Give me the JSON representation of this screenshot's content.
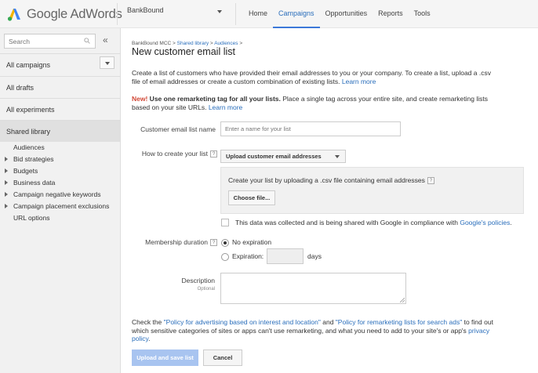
{
  "header": {
    "logo_text": "Google AdWords",
    "account_name": "BankBound",
    "nav": [
      {
        "label": "Home",
        "active": false
      },
      {
        "label": "Campaigns",
        "active": true
      },
      {
        "label": "Opportunities",
        "active": false
      },
      {
        "label": "Reports",
        "active": false
      },
      {
        "label": "Tools",
        "active": false
      }
    ],
    "accent_color": "#3c78d8"
  },
  "sidebar": {
    "search_placeholder": "Search",
    "collapse_glyph": "«",
    "sections": [
      {
        "label": "All campaigns"
      },
      {
        "label": "All drafts"
      },
      {
        "label": "All experiments"
      },
      {
        "label": "Shared library"
      }
    ],
    "library_items": [
      {
        "label": "Audiences",
        "expandable": false
      },
      {
        "label": "Bid strategies",
        "expandable": true
      },
      {
        "label": "Budgets",
        "expandable": true
      },
      {
        "label": "Business data",
        "expandable": true
      },
      {
        "label": "Campaign negative keywords",
        "expandable": true
      },
      {
        "label": "Campaign placement exclusions",
        "expandable": true
      },
      {
        "label": "URL options",
        "expandable": false
      }
    ]
  },
  "main": {
    "breadcrumb": {
      "root": "BankBound MCC",
      "sep": " > ",
      "lib": "Shared library",
      "aud": "Audiences",
      "tail": " >"
    },
    "title": "New customer email list",
    "intro": {
      "text": "Create a list of customers who have provided their email addresses to you or your company. To create a list, upload a .csv file of email addresses or create a custom combination of existing lists. ",
      "link": "Learn more"
    },
    "promo": {
      "badge": "New!",
      "headline": " Use one remarketing tag for all your lists.",
      "text": " Place a single tag across your entire site, and create remarketing lists based on your site URLs. ",
      "link": "Learn more"
    },
    "form": {
      "list_name_label": "Customer email list name",
      "list_name_placeholder": "Enter a name for your list",
      "method_label": "How to create your list",
      "method_value": "Upload customer email addresses",
      "upload_text": "Create your list by uploading a .csv file containing email addresses",
      "choose_file": "Choose file...",
      "consent_text": "This data was collected and is being shared with Google in compliance with ",
      "consent_link": "Google's policies",
      "consent_end": ".",
      "membership_label": "Membership duration",
      "option_no_expiration": "No expiration",
      "option_expiration": "Expiration:",
      "days_label": "days",
      "description_label": "Description",
      "optional_label": "Optional",
      "help_glyph": "?"
    },
    "policy": {
      "t1": "Check the ",
      "l1": "\"Policy for advertising based on interest and location\"",
      "t2": " and ",
      "l2": "\"Policy for remarketing lists for search ads\"",
      "t3": " to find out which sensitive categories of sites or apps can't use remarketing, and what you need to add to your site's or app's ",
      "l3": "privacy policy",
      "t4": "."
    },
    "buttons": {
      "primary": "Upload and save list",
      "cancel": "Cancel"
    }
  }
}
